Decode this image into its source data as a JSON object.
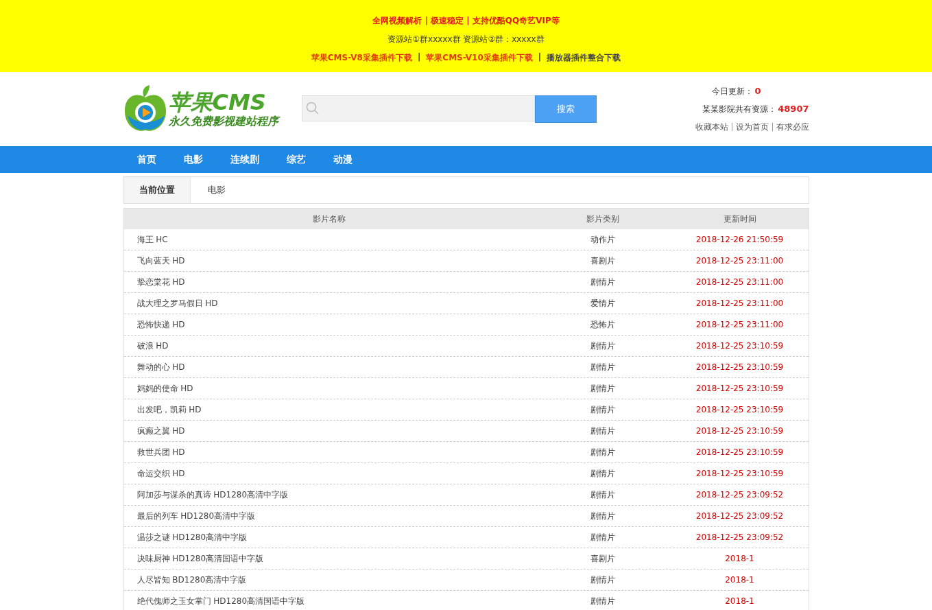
{
  "banner": {
    "headline": "全网视频解析 | 极速稳定 | 支持优酷QQ奇艺VIP等",
    "groups": "资源站①群xxxxx群 资源站②群：xxxxx群",
    "separator": "|",
    "links": [
      {
        "label": "苹果CMS-V8采集插件下载",
        "kind": "red"
      },
      {
        "label": "苹果CMS-V10采集插件下载",
        "kind": "red"
      },
      {
        "label": "播放器插件整合下载",
        "kind": "dark"
      }
    ]
  },
  "logo": {
    "title": "苹果CMS",
    "slogan": "永久免费影视建站程序"
  },
  "search": {
    "button": "搜索"
  },
  "stats": [
    {
      "label": "今日更新：",
      "value": "0"
    },
    {
      "label": "某某影院共有资源：",
      "value": "48907"
    }
  ],
  "quick_links": [
    "收藏本站",
    "设为首页",
    "有求必应"
  ],
  "nav": [
    {
      "label": "首页",
      "selected": false
    },
    {
      "label": "电影",
      "selected": false
    },
    {
      "label": "连续剧",
      "selected": false
    },
    {
      "label": "综艺",
      "selected": false
    },
    {
      "label": "动漫",
      "selected": false
    }
  ],
  "breadcrumb": {
    "label": "当前位置",
    "current": "电影"
  },
  "table": {
    "columns": [
      "影片名称",
      "影片类别",
      "更新时间"
    ],
    "rows": [
      {
        "name": "海王 HC",
        "category": "动作片",
        "time": "2018-12-26 21:50:59"
      },
      {
        "name": "飞向蓝天 HD",
        "category": "喜剧片",
        "time": "2018-12-25 23:11:00"
      },
      {
        "name": "挚恋棠花 HD",
        "category": "剧情片",
        "time": "2018-12-25 23:11:00"
      },
      {
        "name": "战大理之罗马假日 HD",
        "category": "爱情片",
        "time": "2018-12-25 23:11:00"
      },
      {
        "name": "恐怖快递 HD",
        "category": "恐怖片",
        "time": "2018-12-25 23:11:00"
      },
      {
        "name": "破浪 HD",
        "category": "剧情片",
        "time": "2018-12-25 23:10:59"
      },
      {
        "name": "舞动的心 HD",
        "category": "剧情片",
        "time": "2018-12-25 23:10:59"
      },
      {
        "name": "妈妈的使命 HD",
        "category": "剧情片",
        "time": "2018-12-25 23:10:59"
      },
      {
        "name": "出发吧，凯莉 HD",
        "category": "剧情片",
        "time": "2018-12-25 23:10:59"
      },
      {
        "name": "疯癫之翼 HD",
        "category": "剧情片",
        "time": "2018-12-25 23:10:59"
      },
      {
        "name": "救世兵团 HD",
        "category": "剧情片",
        "time": "2018-12-25 23:10:59"
      },
      {
        "name": "命运交织 HD",
        "category": "剧情片",
        "time": "2018-12-25 23:10:59"
      },
      {
        "name": "阿加莎与谋杀的真谛 HD1280高清中字版",
        "category": "剧情片",
        "time": "2018-12-25 23:09:52"
      },
      {
        "name": "最后的列车 HD1280高清中字版",
        "category": "剧情片",
        "time": "2018-12-25 23:09:52"
      },
      {
        "name": "温莎之谜 HD1280高清中字版",
        "category": "剧情片",
        "time": "2018-12-25 23:09:52"
      },
      {
        "name": "决味厨神 HD1280高清国语中字版",
        "category": "喜剧片",
        "time": "2018-1"
      },
      {
        "name": "人尽皆知 BD1280高清中字版",
        "category": "剧情片",
        "time": "2018-1"
      },
      {
        "name": "绝代傀师之玉女掌门 HD1280高清国语中字版",
        "category": "剧情片",
        "time": "2018-1"
      }
    ]
  }
}
